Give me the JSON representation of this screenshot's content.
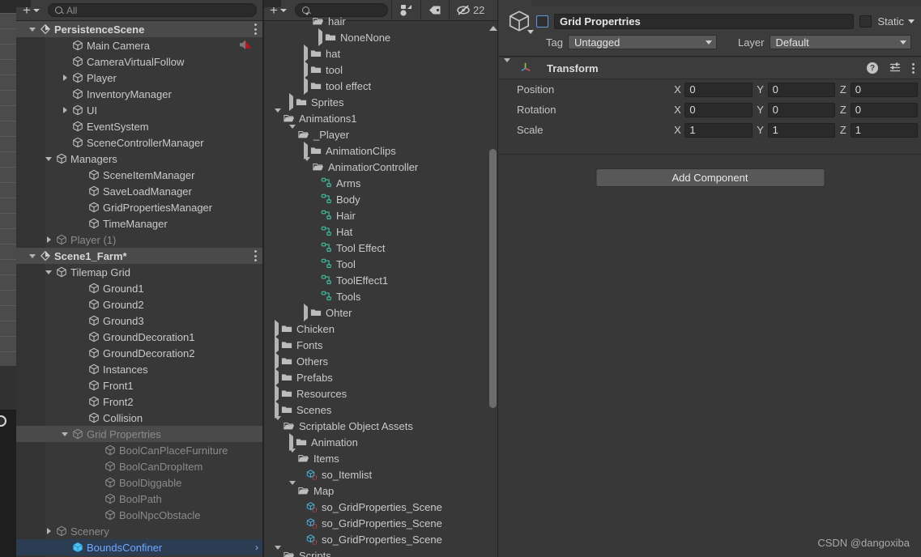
{
  "hierarchy": {
    "toolbar": {
      "add_label": "+",
      "search_placeholder": "All",
      "search_value": ""
    },
    "rows": [
      {
        "label": "PersistenceScene",
        "depth": 1,
        "icon": "unity-scene-icon",
        "twisty": "down",
        "kind": "scene",
        "selected": true,
        "kebab": true
      },
      {
        "label": "Main Camera",
        "depth": 3,
        "icon": "gameobject-cube-icon",
        "twisty": "none",
        "kind": "go",
        "mute": true
      },
      {
        "label": "CameraVirtualFollow",
        "depth": 3,
        "icon": "gameobject-cube-icon",
        "twisty": "none",
        "kind": "go"
      },
      {
        "label": "Player",
        "depth": 3,
        "icon": "gameobject-cube-icon",
        "twisty": "right",
        "kind": "go"
      },
      {
        "label": "InventoryManager",
        "depth": 3,
        "icon": "gameobject-cube-icon",
        "twisty": "none",
        "kind": "go"
      },
      {
        "label": "UI",
        "depth": 3,
        "icon": "gameobject-cube-icon",
        "twisty": "right",
        "kind": "go"
      },
      {
        "label": "EventSystem",
        "depth": 3,
        "icon": "gameobject-cube-icon",
        "twisty": "none",
        "kind": "go"
      },
      {
        "label": "SceneControllerManager",
        "depth": 3,
        "icon": "gameobject-cube-icon",
        "twisty": "none",
        "kind": "go"
      },
      {
        "label": "Managers",
        "depth": 2,
        "icon": "gameobject-cube-icon",
        "twisty": "down",
        "kind": "go"
      },
      {
        "label": "SceneItemManager",
        "depth": 4,
        "icon": "gameobject-cube-icon",
        "twisty": "none",
        "kind": "go"
      },
      {
        "label": "SaveLoadManager",
        "depth": 4,
        "icon": "gameobject-cube-icon",
        "twisty": "none",
        "kind": "go"
      },
      {
        "label": "GridPropertiesManager",
        "depth": 4,
        "icon": "gameobject-cube-icon",
        "twisty": "none",
        "kind": "go"
      },
      {
        "label": "TimeManager",
        "depth": 4,
        "icon": "gameobject-cube-icon",
        "twisty": "none",
        "kind": "go"
      },
      {
        "label": "Player (1)",
        "depth": 2,
        "icon": "gameobject-cube-icon",
        "twisty": "right",
        "kind": "go",
        "dim": true
      },
      {
        "label": "Scene1_Farm*",
        "depth": 1,
        "icon": "unity-scene-icon",
        "twisty": "down",
        "kind": "scene",
        "selected": true,
        "kebab": true
      },
      {
        "label": "Tilemap Grid",
        "depth": 2,
        "icon": "gameobject-cube-icon",
        "twisty": "down",
        "kind": "go"
      },
      {
        "label": "Ground1",
        "depth": 4,
        "icon": "gameobject-cube-icon",
        "twisty": "none",
        "kind": "go"
      },
      {
        "label": "Ground2",
        "depth": 4,
        "icon": "gameobject-cube-icon",
        "twisty": "none",
        "kind": "go"
      },
      {
        "label": "Ground3",
        "depth": 4,
        "icon": "gameobject-cube-icon",
        "twisty": "none",
        "kind": "go"
      },
      {
        "label": "GroundDecoration1",
        "depth": 4,
        "icon": "gameobject-cube-icon",
        "twisty": "none",
        "kind": "go"
      },
      {
        "label": "GroundDecoration2",
        "depth": 4,
        "icon": "gameobject-cube-icon",
        "twisty": "none",
        "kind": "go"
      },
      {
        "label": "Instances",
        "depth": 4,
        "icon": "gameobject-cube-icon",
        "twisty": "none",
        "kind": "go"
      },
      {
        "label": "Front1",
        "depth": 4,
        "icon": "gameobject-cube-icon",
        "twisty": "none",
        "kind": "go"
      },
      {
        "label": "Front2",
        "depth": 4,
        "icon": "gameobject-cube-icon",
        "twisty": "none",
        "kind": "go"
      },
      {
        "label": "Collision",
        "depth": 4,
        "icon": "gameobject-cube-icon",
        "twisty": "none",
        "kind": "go"
      },
      {
        "label": "Grid Propertries",
        "depth": 3,
        "icon": "gameobject-cube-icon",
        "twisty": "down",
        "kind": "go",
        "selected": true,
        "dim": true
      },
      {
        "label": "BoolCanPlaceFurniture",
        "depth": 5,
        "icon": "gameobject-cube-icon",
        "twisty": "none",
        "kind": "go",
        "dim": true
      },
      {
        "label": "BoolCanDropItem",
        "depth": 5,
        "icon": "gameobject-cube-icon",
        "twisty": "none",
        "kind": "go",
        "dim": true
      },
      {
        "label": "BoolDiggable",
        "depth": 5,
        "icon": "gameobject-cube-icon",
        "twisty": "none",
        "kind": "go",
        "dim": true
      },
      {
        "label": "BoolPath",
        "depth": 5,
        "icon": "gameobject-cube-icon",
        "twisty": "none",
        "kind": "go",
        "dim": true
      },
      {
        "label": "BoolNpcObstacle",
        "depth": 5,
        "icon": "gameobject-cube-icon",
        "twisty": "none",
        "kind": "go",
        "dim": true
      },
      {
        "label": "Scenery",
        "depth": 2,
        "icon": "gameobject-cube-icon",
        "twisty": "right",
        "kind": "go",
        "dim": true
      },
      {
        "label": "BoundsConfiner",
        "depth": 3,
        "icon": "prefab-cube-icon",
        "twisty": "none",
        "kind": "prefab",
        "selectedBlue": true,
        "chevron": true
      }
    ]
  },
  "project": {
    "toolbar": {
      "add_label": "+",
      "search_value": "",
      "filter_type_icon": "filter-by-type-icon",
      "filter_label_icon": "filter-by-label-icon",
      "hidden_icon": "eye-slash-icon",
      "hidden_count": "22"
    },
    "rows": [
      {
        "label": "hair",
        "depth": 3,
        "icon": "folder-open-icon",
        "twisty": "down",
        "clipped": true
      },
      {
        "label": "NoneNone",
        "depth": 4,
        "icon": "folder-icon",
        "twisty": "right"
      },
      {
        "label": "hat",
        "depth": 3,
        "icon": "folder-icon",
        "twisty": "right"
      },
      {
        "label": "tool",
        "depth": 3,
        "icon": "folder-icon",
        "twisty": "right"
      },
      {
        "label": "tool effect",
        "depth": 3,
        "icon": "folder-icon",
        "twisty": "right"
      },
      {
        "label": "Sprites",
        "depth": 2,
        "icon": "folder-icon",
        "twisty": "right"
      },
      {
        "label": "Animations1",
        "depth": 1,
        "icon": "folder-open-icon",
        "twisty": "down"
      },
      {
        "label": "_Player",
        "depth": 2,
        "icon": "folder-open-icon",
        "twisty": "down"
      },
      {
        "label": "AnimationClips",
        "depth": 3,
        "icon": "folder-icon",
        "twisty": "right"
      },
      {
        "label": "AnimatiorController",
        "depth": 3,
        "icon": "folder-open-icon",
        "twisty": "down"
      },
      {
        "label": "Arms",
        "depth": 4,
        "icon": "animator-controller-icon",
        "twisty": "none"
      },
      {
        "label": "Body",
        "depth": 4,
        "icon": "animator-controller-icon",
        "twisty": "none"
      },
      {
        "label": "Hair",
        "depth": 4,
        "icon": "animator-controller-icon",
        "twisty": "none"
      },
      {
        "label": "Hat",
        "depth": 4,
        "icon": "animator-controller-icon",
        "twisty": "none"
      },
      {
        "label": "Tool Effect",
        "depth": 4,
        "icon": "animator-controller-icon",
        "twisty": "none"
      },
      {
        "label": "Tool",
        "depth": 4,
        "icon": "animator-controller-icon",
        "twisty": "none"
      },
      {
        "label": "ToolEffect1",
        "depth": 4,
        "icon": "animator-controller-icon",
        "twisty": "none"
      },
      {
        "label": "Tools",
        "depth": 4,
        "icon": "animator-controller-icon",
        "twisty": "none"
      },
      {
        "label": "Ohter",
        "depth": 3,
        "icon": "folder-icon",
        "twisty": "right"
      },
      {
        "label": "Chicken",
        "depth": 1,
        "icon": "folder-icon",
        "twisty": "right"
      },
      {
        "label": "Fonts",
        "depth": 1,
        "icon": "folder-icon",
        "twisty": "right"
      },
      {
        "label": "Others",
        "depth": 1,
        "icon": "folder-icon",
        "twisty": "right"
      },
      {
        "label": "Prefabs",
        "depth": 1,
        "icon": "folder-icon",
        "twisty": "right"
      },
      {
        "label": "Resources",
        "depth": 1,
        "icon": "folder-icon",
        "twisty": "right"
      },
      {
        "label": "Scenes",
        "depth": 1,
        "icon": "folder-icon",
        "twisty": "right"
      },
      {
        "label": "Scriptable Object Assets",
        "depth": 1,
        "icon": "folder-open-icon",
        "twisty": "down"
      },
      {
        "label": "Animation",
        "depth": 2,
        "icon": "folder-icon",
        "twisty": "right"
      },
      {
        "label": "Items",
        "depth": 2,
        "icon": "folder-open-icon",
        "twisty": "down"
      },
      {
        "label": "so_Itemlist",
        "depth": 3,
        "icon": "scriptable-object-icon",
        "twisty": "none"
      },
      {
        "label": "Map",
        "depth": 2,
        "icon": "folder-open-icon",
        "twisty": "down"
      },
      {
        "label": "so_GridProperties_Scene",
        "depth": 3,
        "icon": "scriptable-object-icon",
        "twisty": "none"
      },
      {
        "label": "so_GridProperties_Scene",
        "depth": 3,
        "icon": "scriptable-object-icon",
        "twisty": "none"
      },
      {
        "label": "so_GridProperties_Scene",
        "depth": 3,
        "icon": "scriptable-object-icon",
        "twisty": "none"
      },
      {
        "label": "Scripts",
        "depth": 1,
        "icon": "folder-open-icon",
        "twisty": "down",
        "clipped": true
      }
    ]
  },
  "inspector": {
    "gameobject_icon": "gameobject-cube-icon",
    "enabled_checkbox": "enabled-checkbox",
    "name_value": "Grid Propertries",
    "static_checkbox": "static-checkbox",
    "static_label": "Static",
    "tag_label": "Tag",
    "tag_value": "Untagged",
    "layer_label": "Layer",
    "layer_value": "Default",
    "component": {
      "title": "Transform",
      "icon": "transform-axis-icon",
      "help_icon": "help-icon",
      "preset_icon": "preset-icon",
      "menu_icon": "kebab-menu-icon",
      "rows": [
        {
          "label": "Position",
          "x": "0",
          "y": "0",
          "z": "0"
        },
        {
          "label": "Rotation",
          "x": "0",
          "y": "0",
          "z": "0"
        },
        {
          "label": "Scale",
          "x": "1",
          "y": "1",
          "z": "1"
        }
      ],
      "axis_labels": {
        "x": "X",
        "y": "Y",
        "z": "Z"
      }
    },
    "add_component_label": "Add Component"
  },
  "watermark": "CSDN @dangoxiba",
  "colors": {
    "panel_bg": "#383838",
    "toolbar_bg": "#3c3c3c",
    "selection": "#4a4a4a",
    "selection_blue": "#2c3c52",
    "prefab_blue": "#6fa9ff",
    "accent_teal": "#3fbfa0",
    "checkbox_outline": "#5a9ae0"
  }
}
